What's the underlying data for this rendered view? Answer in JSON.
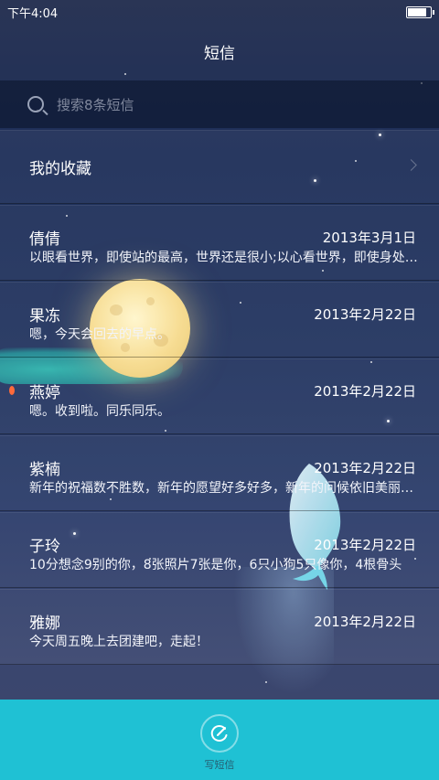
{
  "status_bar": {
    "time": "下午4:04",
    "battery_level": 0.9
  },
  "header": {
    "title": "短信"
  },
  "search": {
    "placeholder": "搜索8条短信"
  },
  "favorites": {
    "label": "我的收藏"
  },
  "conversations": [
    {
      "name": "倩倩",
      "date": "2013年3月1日",
      "preview": "以眼看世界，即使站的最高，世界还是很小;以心看世界，即使身处最卑微的地方",
      "unread": false
    },
    {
      "name": "果冻",
      "date": "2013年2月22日",
      "preview": "嗯，今天会回去的早点。",
      "unread": false
    },
    {
      "name": "燕婷",
      "date": "2013年2月22日",
      "preview": "嗯。收到啦。同乐同乐。",
      "unread": true
    },
    {
      "name": "紫楠",
      "date": "2013年2月22日",
      "preview": "新年的祝福数不胜数，新年的愿望好多好多，新年的问候依旧美丽如初",
      "unread": false
    },
    {
      "name": "子玲",
      "date": "2013年2月22日",
      "preview": "10分想念9别的你，8张照片7张是你，6只小狗5只像你，4根骨头",
      "unread": false
    },
    {
      "name": "雅娜",
      "date": "2013年2月22日",
      "preview": "今天周五晚上去团建吧，走起！",
      "unread": false
    }
  ],
  "compose": {
    "label": "写短信",
    "icon": "compose-icon"
  },
  "colors": {
    "accent_bar": "#1fc1d4",
    "unread_dot": "#ff6a3a"
  }
}
